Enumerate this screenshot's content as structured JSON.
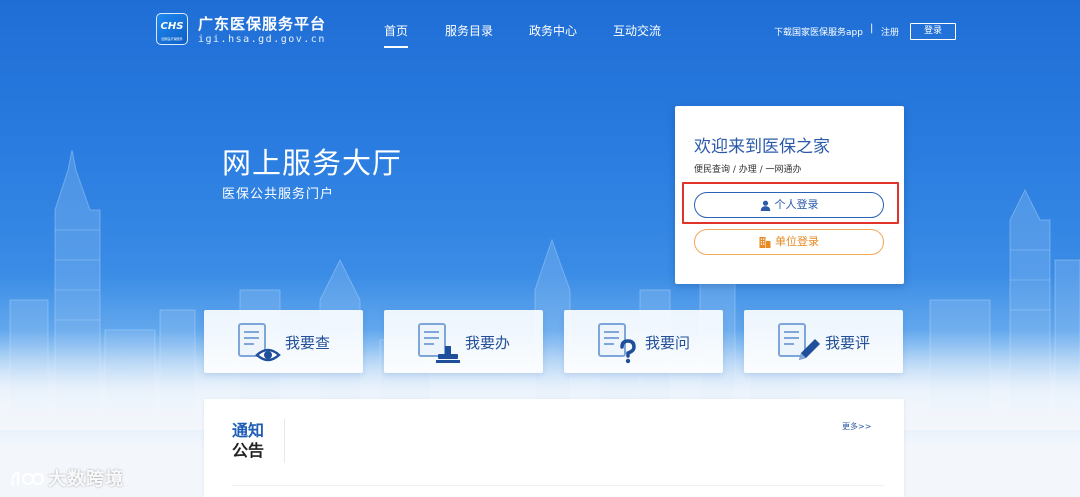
{
  "header": {
    "logo_text": "CHS",
    "logo_subtext": "国家医疗保障局",
    "title": "广东医保服务平台",
    "domain": "igi.hsa.gd.gov.cn",
    "nav": [
      {
        "label": "首页",
        "active": true
      },
      {
        "label": "服务目录",
        "active": false
      },
      {
        "label": "政务中心",
        "active": false
      },
      {
        "label": "互动交流",
        "active": false
      }
    ],
    "download_app": "下载国家医保服务app",
    "sep": "|",
    "register": "注册",
    "login": "登录"
  },
  "hero": {
    "title": "网上服务大厅",
    "subtitle": "医保公共服务门户"
  },
  "login_card": {
    "title": "欢迎来到医保之家",
    "desc": "便民查询 / 办理 / 一网通办",
    "personal_login": "个人登录",
    "unit_login": "单位登录",
    "personal_icon": "user-icon",
    "unit_icon": "building-icon"
  },
  "services": [
    {
      "label": "我要查",
      "icon": "document-eye-icon"
    },
    {
      "label": "我要办",
      "icon": "document-stamp-icon"
    },
    {
      "label": "我要问",
      "icon": "document-question-icon"
    },
    {
      "label": "我要评",
      "icon": "document-pen-icon"
    }
  ],
  "notice": {
    "title_line1": "通知",
    "title_line2": "公告",
    "more": "更多>>"
  },
  "watermark": "大数跨境",
  "colors": {
    "brand_blue": "#1f6ed6",
    "title_blue": "#2a5aa8",
    "accent_orange": "#f0a958",
    "highlight_red": "#e2332b"
  }
}
